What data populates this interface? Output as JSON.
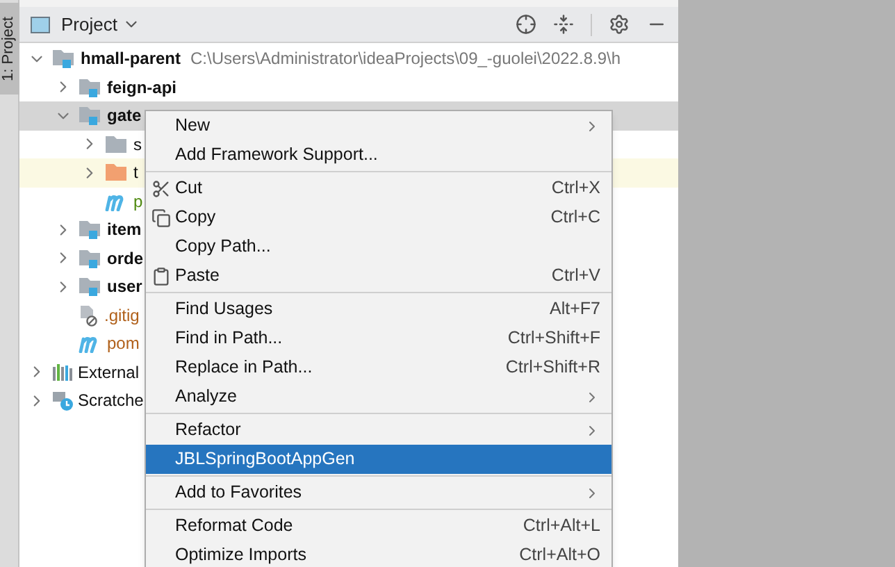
{
  "side_tab": {
    "label": "1: Project",
    "selected": true
  },
  "header": {
    "title": "Project"
  },
  "tree": [
    {
      "label": "hmall-parent",
      "hint": "C:\\Users\\Administrator\\ideaProjects\\09_-guolei\\2022.8.9\\h",
      "kind": "module",
      "expanded": true,
      "selected": false,
      "children": [
        {
          "label": "feign-api",
          "kind": "module",
          "expanded": false,
          "selected": false
        },
        {
          "label": "gate",
          "kind": "module",
          "expanded": true,
          "selected": true,
          "children": [
            {
              "label": "s",
              "kind": "folder",
              "expanded": false,
              "selected": false
            },
            {
              "label": "t",
              "kind": "excluded",
              "expanded": false,
              "selected": false
            },
            {
              "label": "p",
              "kind": "pom",
              "selected": false,
              "color": "#4f8a10"
            }
          ]
        },
        {
          "label": "item",
          "kind": "module",
          "expanded": false,
          "selected": false
        },
        {
          "label": "orde",
          "kind": "module",
          "expanded": false,
          "selected": false
        },
        {
          "label": "user",
          "kind": "module",
          "expanded": false,
          "selected": false
        },
        {
          "label": ".gitig",
          "kind": "ignore",
          "selected": false,
          "color": "#b0601a"
        },
        {
          "label": "pom",
          "kind": "pom",
          "selected": false,
          "color": "#b0601a"
        }
      ]
    },
    {
      "label": "External",
      "kind": "libraries",
      "expanded": false,
      "selected": false
    },
    {
      "label": "Scratche",
      "kind": "scratches",
      "expanded": false,
      "selected": false
    }
  ],
  "menu": [
    {
      "label": "New",
      "kind": "plain",
      "submenu": true,
      "selected": false
    },
    {
      "label": "Add Framework Support...",
      "kind": "plain",
      "selected": false
    },
    {
      "label": "Cut",
      "kind": "cut",
      "shortcut": "Ctrl+X",
      "separator_before": true,
      "selected": false
    },
    {
      "label": "Copy",
      "kind": "copy",
      "shortcut": "Ctrl+C",
      "selected": false
    },
    {
      "label": "Copy Path...",
      "kind": "plain",
      "selected": false
    },
    {
      "label": "Paste",
      "kind": "paste",
      "shortcut": "Ctrl+V",
      "selected": false
    },
    {
      "label": "Find Usages",
      "kind": "plain",
      "shortcut": "Alt+F7",
      "separator_before": true,
      "selected": false
    },
    {
      "label": "Find in Path...",
      "kind": "plain",
      "shortcut": "Ctrl+Shift+F",
      "selected": false
    },
    {
      "label": "Replace in Path...",
      "kind": "plain",
      "shortcut": "Ctrl+Shift+R",
      "selected": false
    },
    {
      "label": "Analyze",
      "kind": "plain",
      "submenu": true,
      "selected": false
    },
    {
      "label": "Refactor",
      "kind": "plain",
      "submenu": true,
      "separator_before": true,
      "selected": false
    },
    {
      "label": "JBLSpringBootAppGen",
      "kind": "plain",
      "selected": true
    },
    {
      "label": "Add to Favorites",
      "kind": "plain",
      "submenu": true,
      "separator_before": true,
      "selected": false
    },
    {
      "label": "Reformat Code",
      "kind": "plain",
      "shortcut": "Ctrl+Alt+L",
      "separator_before": true,
      "selected": false
    },
    {
      "label": "Optimize Imports",
      "kind": "plain",
      "shortcut": "Ctrl+Alt+O",
      "selected": false
    }
  ]
}
